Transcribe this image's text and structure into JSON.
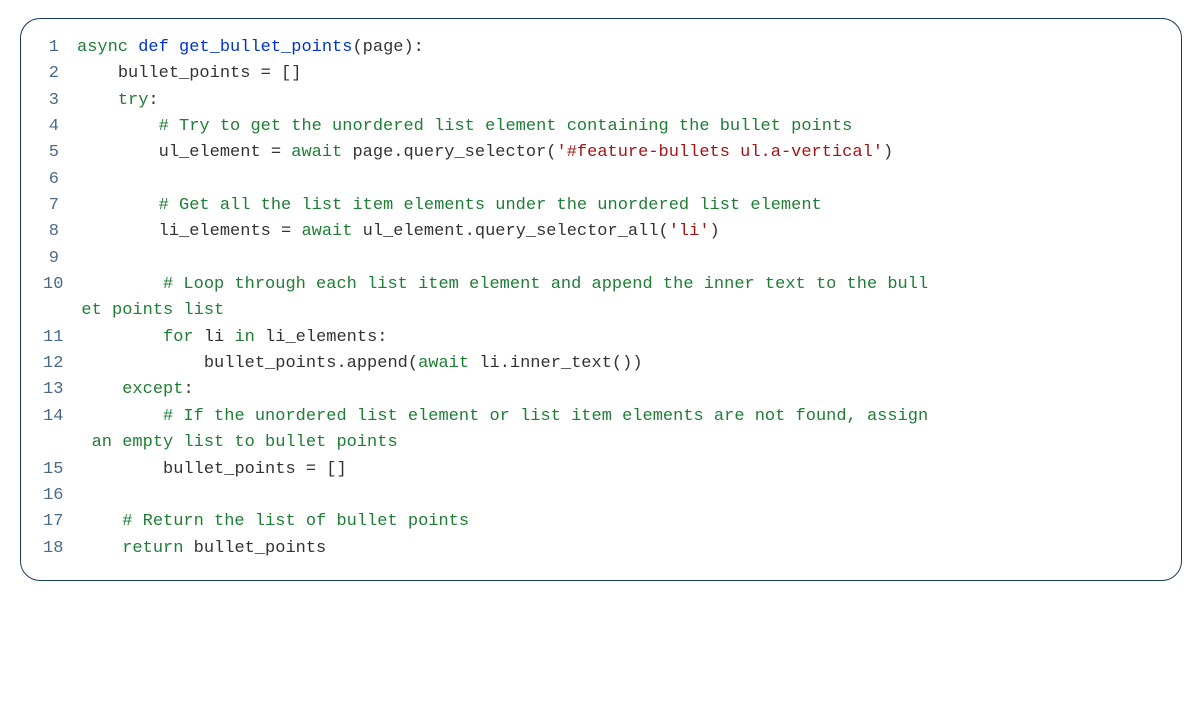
{
  "code": {
    "lines": [
      {
        "num": "1",
        "tokens": [
          {
            "cls": "kw-async",
            "text": "async"
          },
          {
            "cls": "default-text",
            "text": " "
          },
          {
            "cls": "kw-def",
            "text": "def"
          },
          {
            "cls": "default-text",
            "text": " "
          },
          {
            "cls": "fn-name",
            "text": "get_bullet_points"
          },
          {
            "cls": "default-text",
            "text": "(page):"
          }
        ]
      },
      {
        "num": "2",
        "tokens": [
          {
            "cls": "default-text",
            "text": "    bullet_points = []"
          }
        ]
      },
      {
        "num": "3",
        "tokens": [
          {
            "cls": "default-text",
            "text": "    "
          },
          {
            "cls": "kw-try",
            "text": "try"
          },
          {
            "cls": "default-text",
            "text": ":"
          }
        ]
      },
      {
        "num": "4",
        "tokens": [
          {
            "cls": "default-text",
            "text": "        "
          },
          {
            "cls": "comment",
            "text": "# Try to get the unordered list element containing the bullet points"
          }
        ]
      },
      {
        "num": "5",
        "tokens": [
          {
            "cls": "default-text",
            "text": "        ul_element = "
          },
          {
            "cls": "kw-await",
            "text": "await"
          },
          {
            "cls": "default-text",
            "text": " page.query_selector("
          },
          {
            "cls": "string",
            "text": "'#feature-bullets ul.a-vertical'"
          },
          {
            "cls": "default-text",
            "text": ")"
          }
        ]
      },
      {
        "num": "6",
        "tokens": [
          {
            "cls": "default-text",
            "text": ""
          }
        ]
      },
      {
        "num": "7",
        "tokens": [
          {
            "cls": "default-text",
            "text": "        "
          },
          {
            "cls": "comment",
            "text": "# Get all the list item elements under the unordered list element"
          }
        ]
      },
      {
        "num": "8",
        "tokens": [
          {
            "cls": "default-text",
            "text": "        li_elements = "
          },
          {
            "cls": "kw-await",
            "text": "await"
          },
          {
            "cls": "default-text",
            "text": " ul_element.query_selector_all("
          },
          {
            "cls": "string",
            "text": "'li'"
          },
          {
            "cls": "default-text",
            "text": ")"
          }
        ]
      },
      {
        "num": "9",
        "tokens": [
          {
            "cls": "default-text",
            "text": ""
          }
        ]
      },
      {
        "num": "10",
        "tokens": [
          {
            "cls": "default-text",
            "text": "        "
          },
          {
            "cls": "comment",
            "text": "# Loop through each list item element and append the inner text to the bull"
          }
        ],
        "wrap": [
          {
            "cls": "comment",
            "text": "et points list"
          }
        ]
      },
      {
        "num": "11",
        "tokens": [
          {
            "cls": "default-text",
            "text": "        "
          },
          {
            "cls": "kw-for",
            "text": "for"
          },
          {
            "cls": "default-text",
            "text": " li "
          },
          {
            "cls": "kw-in",
            "text": "in"
          },
          {
            "cls": "default-text",
            "text": " li_elements:"
          }
        ]
      },
      {
        "num": "12",
        "tokens": [
          {
            "cls": "default-text",
            "text": "            bullet_points.append("
          },
          {
            "cls": "kw-await",
            "text": "await"
          },
          {
            "cls": "default-text",
            "text": " li.inner_text())"
          }
        ]
      },
      {
        "num": "13",
        "tokens": [
          {
            "cls": "default-text",
            "text": "    "
          },
          {
            "cls": "kw-except",
            "text": "except"
          },
          {
            "cls": "default-text",
            "text": ":"
          }
        ]
      },
      {
        "num": "14",
        "tokens": [
          {
            "cls": "default-text",
            "text": "        "
          },
          {
            "cls": "comment",
            "text": "# If the unordered list element or list item elements are not found, assign"
          }
        ],
        "wrap": [
          {
            "cls": "comment",
            "text": " an empty list to bullet points"
          }
        ]
      },
      {
        "num": "15",
        "tokens": [
          {
            "cls": "default-text",
            "text": "        bullet_points = []"
          }
        ]
      },
      {
        "num": "16",
        "tokens": [
          {
            "cls": "default-text",
            "text": ""
          }
        ]
      },
      {
        "num": "17",
        "tokens": [
          {
            "cls": "default-text",
            "text": "    "
          },
          {
            "cls": "comment",
            "text": "# Return the list of bullet points"
          }
        ]
      },
      {
        "num": "18",
        "tokens": [
          {
            "cls": "default-text",
            "text": "    "
          },
          {
            "cls": "kw-return",
            "text": "return"
          },
          {
            "cls": "default-text",
            "text": " bullet_points"
          }
        ]
      }
    ]
  }
}
